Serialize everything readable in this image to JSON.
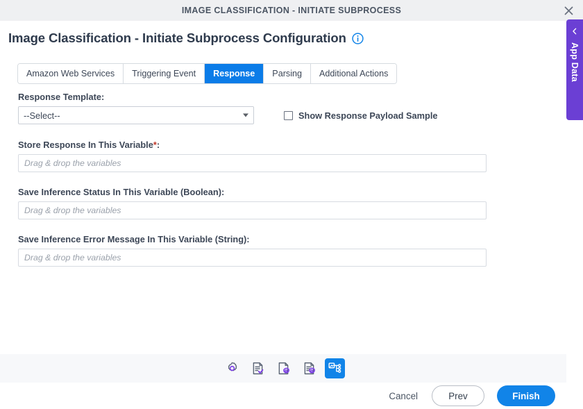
{
  "window": {
    "title": "IMAGE CLASSIFICATION - INITIATE SUBPROCESS",
    "close_icon": "close-icon"
  },
  "page": {
    "heading": "Image Classification - Initiate Subprocess Configuration",
    "info_icon": "info-circle-icon"
  },
  "tabs": [
    {
      "label": "Amazon Web Services",
      "active": false
    },
    {
      "label": "Triggering Event",
      "active": false
    },
    {
      "label": "Response",
      "active": true
    },
    {
      "label": "Parsing",
      "active": false
    },
    {
      "label": "Additional Actions",
      "active": false
    }
  ],
  "form": {
    "response_template": {
      "label": "Response Template:",
      "value": "--Select--",
      "caret_icon": "chevron-down-icon"
    },
    "show_payload": {
      "label": "Show Response Payload Sample",
      "checked": false
    },
    "store_response": {
      "label": "Store Response In This Variable",
      "required_mark": "*",
      "label_suffix": ":",
      "placeholder": "Drag & drop the variables",
      "value": ""
    },
    "inference_status": {
      "label": "Save Inference Status In This Variable (Boolean):",
      "placeholder": "Drag & drop the variables",
      "value": ""
    },
    "inference_error": {
      "label": "Save Inference Error Message In This Variable (String):",
      "placeholder": "Drag & drop the variables",
      "value": ""
    }
  },
  "icon_toolbar": [
    {
      "name": "general-settings-icon",
      "active": false
    },
    {
      "name": "document-check-icon",
      "active": false
    },
    {
      "name": "document-gear-icon",
      "active": false
    },
    {
      "name": "document-lines-gear-icon",
      "active": false
    },
    {
      "name": "process-flow-icon",
      "active": true
    }
  ],
  "footer": {
    "cancel_label": "Cancel",
    "prev_label": "Prev",
    "finish_label": "Finish"
  },
  "app_data_panel": {
    "label": "App Data",
    "collapse_icon": "chevron-left-icon"
  },
  "colors": {
    "accent_blue": "#1184e8",
    "tab_active_blue": "#0b7ce8",
    "purple_panel": "#6b3fd4",
    "icon_purple": "#7b3fe4",
    "required_red": "#c0392b",
    "titlebar_bg": "#eff0f2",
    "toolbar_bg": "#f7f8fa",
    "text_dark": "#3d4757"
  }
}
